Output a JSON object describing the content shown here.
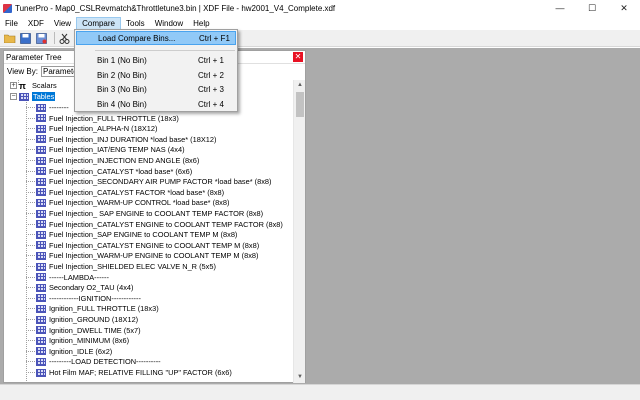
{
  "window": {
    "title": "TunerPro - Map0_CSLRevmatch&Throttletune3.bin | XDF File - hw2001_V4_Complete.xdf",
    "minimize_glyph": "—",
    "maximize_glyph": "☐",
    "close_glyph": "✕"
  },
  "menu": {
    "items": [
      "File",
      "XDF",
      "View",
      "Compare",
      "Tools",
      "Window",
      "Help"
    ]
  },
  "toolbar": {
    "icons": [
      "open-folder-icon",
      "save-icon",
      "save-as-icon",
      "cut-icon",
      "copy-icon",
      "chart-icon",
      "tables-icon",
      "search-icon",
      "compare-icon",
      "settings-icon"
    ]
  },
  "compare_menu": {
    "items": [
      {
        "label": "Load Compare Bins...",
        "shortcut": "Ctrl + F1",
        "highlighted": true
      },
      {
        "label": "Bin 1 (No Bin)",
        "shortcut": "Ctrl + 1"
      },
      {
        "label": "Bin 2 (No Bin)",
        "shortcut": "Ctrl + 2"
      },
      {
        "label": "Bin 3 (No Bin)",
        "shortcut": "Ctrl + 3"
      },
      {
        "label": "Bin 4 (No Bin)",
        "shortcut": "Ctrl + 4"
      }
    ]
  },
  "panel": {
    "title": "Parameter Tree",
    "close_glyph": "✕",
    "view_by_label": "View By:",
    "view_by_value": "Parameter",
    "scroll_up": "▲",
    "scroll_down": "▼"
  },
  "tree": {
    "expand_glyph": "+",
    "collapse_glyph": "−",
    "pi_glyph": "π",
    "scalars_label": "Scalars",
    "tables_label": "Tables",
    "items": [
      "--------",
      "Fuel Injection_FULL THROTTLE (18x3)",
      "Fuel Injection_ALPHA-N (18X12)",
      "Fuel Injection_INJ DURATION *load base* (18X12)",
      "Fuel Injection_IAT/ENG TEMP NAS (4x4)",
      "Fuel Injection_INJECTION END ANGLE (8x6)",
      "Fuel Injection_CATALYST *load base* (6x6)",
      "Fuel Injection_SECONDARY AIR PUMP FACTOR *load base* (8x8)",
      "Fuel Injection_CATALYST FACTOR *load base* (8x8)",
      "Fuel Injection_WARM-UP CONTROL *load base* (8x8)",
      "Fuel Injection_ SAP ENGINE to COOLANT TEMP FACTOR (8x8)",
      "Fuel Injection_CATALYST ENGINE to COOLANT TEMP FACTOR (8x8)",
      "Fuel Injection_SAP ENGINE to COOLANT TEMP M (8x8)",
      "Fuel Injection_CATALYST ENGINE to COOLANT TEMP M (8x8)",
      "Fuel Injection_WARM-UP ENGINE to COOLANT TEMP M (8x8)",
      "Fuel Injection_SHIELDED ELEC VALVE N_R (5x5)",
      "------LAMBDA------",
      "Secondary O2_TAU (4x4)",
      "------------IGNITION------------",
      "Ignition_FULL THROTTLE (18x3)",
      "Ignition_GROUND (18X12)",
      "Ignition_DWELL TIME (5x7)",
      "Ignition_MINIMUM (8x6)",
      "Ignition_IDLE (6x2)",
      "---------LOAD DETECTION----------",
      "Hot Film MAF; RELATIVE FILLING \"UP\" FACTOR (6x6)"
    ]
  }
}
